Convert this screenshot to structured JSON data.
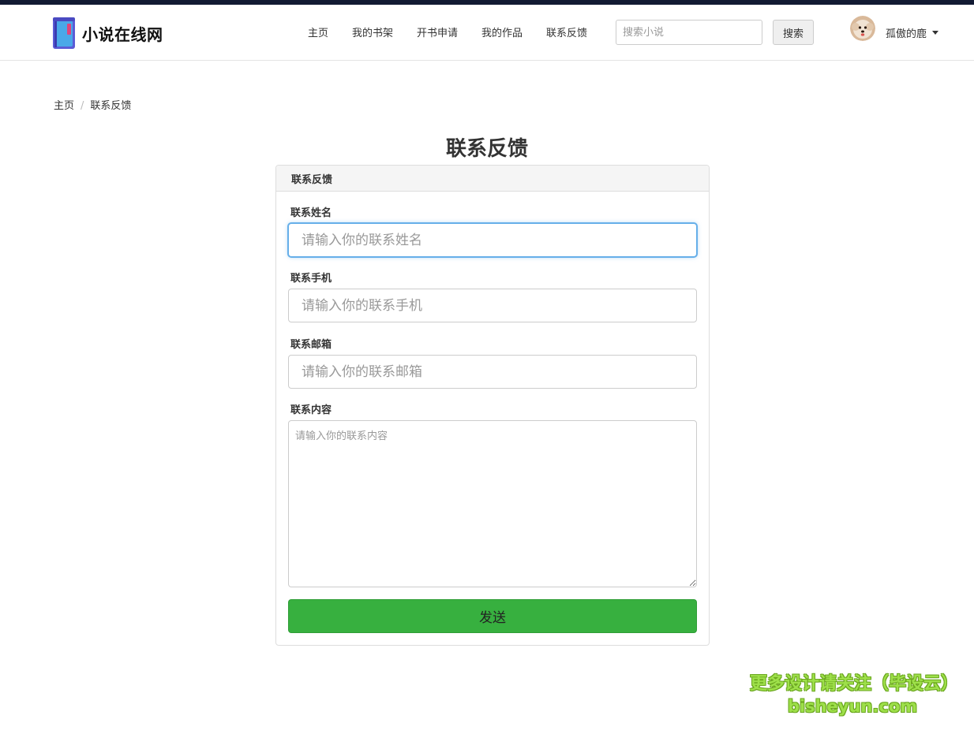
{
  "brand": {
    "name": "小说在线网"
  },
  "nav": {
    "items": [
      {
        "label": "主页"
      },
      {
        "label": "我的书架"
      },
      {
        "label": "开书申请"
      },
      {
        "label": "我的作品"
      },
      {
        "label": "联系反馈"
      }
    ]
  },
  "search": {
    "placeholder": "搜索小说",
    "button_label": "搜索"
  },
  "user": {
    "name": "孤傲的鹿",
    "avatar_icon": "dog-avatar"
  },
  "breadcrumb": {
    "home": "主页",
    "separator": "/",
    "current": "联系反馈"
  },
  "page": {
    "title": "联系反馈"
  },
  "form": {
    "heading": "联系反馈",
    "name_label": "联系姓名",
    "name_placeholder": "请输入你的联系姓名",
    "phone_label": "联系手机",
    "phone_placeholder": "请输入你的联系手机",
    "email_label": "联系邮箱",
    "email_placeholder": "请输入你的联系邮箱",
    "content_label": "联系内容",
    "content_placeholder": "请输入你的联系内容",
    "submit_label": "发送"
  },
  "watermark": {
    "line1": "更多设计请关注（毕设云）",
    "line2": "bisheyun.com"
  },
  "colors": {
    "primary_button": "#37b03f",
    "top_strip": "#121a33",
    "focus_border": "#66afe9",
    "brand_logo": "#5b5bd6"
  }
}
